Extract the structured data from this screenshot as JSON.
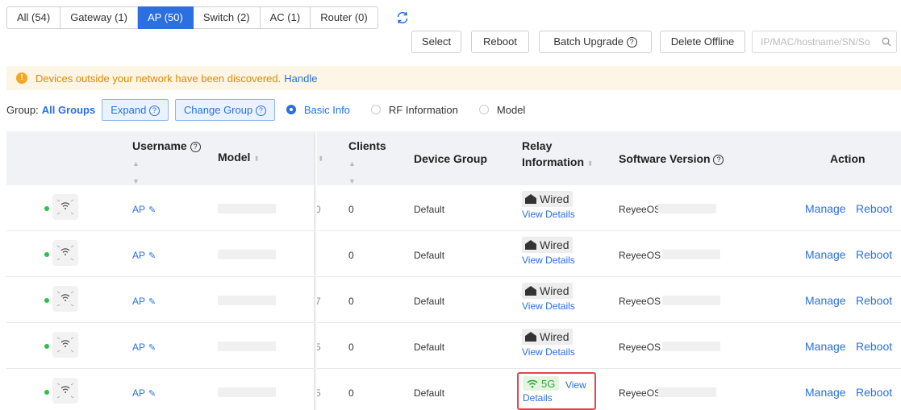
{
  "tabs": [
    {
      "label": "All (54)",
      "active": false
    },
    {
      "label": "Gateway (1)",
      "active": false
    },
    {
      "label": "AP (50)",
      "active": true
    },
    {
      "label": "Switch (2)",
      "active": false
    },
    {
      "label": "AC (1)",
      "active": false
    },
    {
      "label": "Router (0)",
      "active": false
    }
  ],
  "toolbar": {
    "select": "Select",
    "reboot": "Reboot",
    "batch_upgrade": "Batch Upgrade",
    "delete_offline": "Delete Offline",
    "search_placeholder": "IP/MAC/hostname/SN/So"
  },
  "notice": {
    "text": "Devices outside your network have been discovered.",
    "link": "Handle"
  },
  "groupbar": {
    "label": "Group:",
    "group": "All Groups",
    "expand": "Expand",
    "change_group": "Change Group",
    "views": [
      {
        "label": "Basic Info",
        "selected": true
      },
      {
        "label": "RF Information",
        "selected": false
      },
      {
        "label": "Model",
        "selected": false
      }
    ]
  },
  "columns": {
    "username": "Username",
    "model": "Model",
    "clients": "Clients",
    "device_group": "Device Group",
    "relay_line1": "Relay",
    "relay_line2": "Information",
    "software": "Software Version",
    "action": "Action"
  },
  "rows": [
    {
      "username": "AP",
      "hidden_digit": "0",
      "clients": "0",
      "group": "Default",
      "relay": "Wired",
      "view": "View Details",
      "software": "ReyeeOS",
      "manage": "Manage",
      "reboot": "Reboot"
    },
    {
      "username": "AP",
      "hidden_digit": "",
      "clients": "0",
      "group": "Default",
      "relay": "Wired",
      "view": "View Details",
      "software": "ReyeeOS :",
      "manage": "Manage",
      "reboot": "Reboot"
    },
    {
      "username": "AP",
      "hidden_digit": "7",
      "clients": "0",
      "group": "Default",
      "relay": "Wired",
      "view": "View Details",
      "software": "ReyeeOS :",
      "manage": "Manage",
      "reboot": "Reboot"
    },
    {
      "username": "AP",
      "hidden_digit": "5",
      "clients": "0",
      "group": "Default",
      "relay": "Wired",
      "view": "View Details",
      "software": "ReyeeOS 2",
      "manage": "Manage",
      "reboot": "Reboot"
    },
    {
      "username": "AP",
      "hidden_digit": "5",
      "clients": "0",
      "group": "Default",
      "relay": "5G",
      "view_a": "View",
      "view_b": "Details",
      "software": "ReyeeOS",
      "manage": "Manage",
      "reboot": "Reboot"
    }
  ],
  "colors": {
    "accent": "#2b6fe0",
    "online": "#2fbf4a",
    "warning": "#f5a623",
    "highlight": "#e0474c"
  }
}
